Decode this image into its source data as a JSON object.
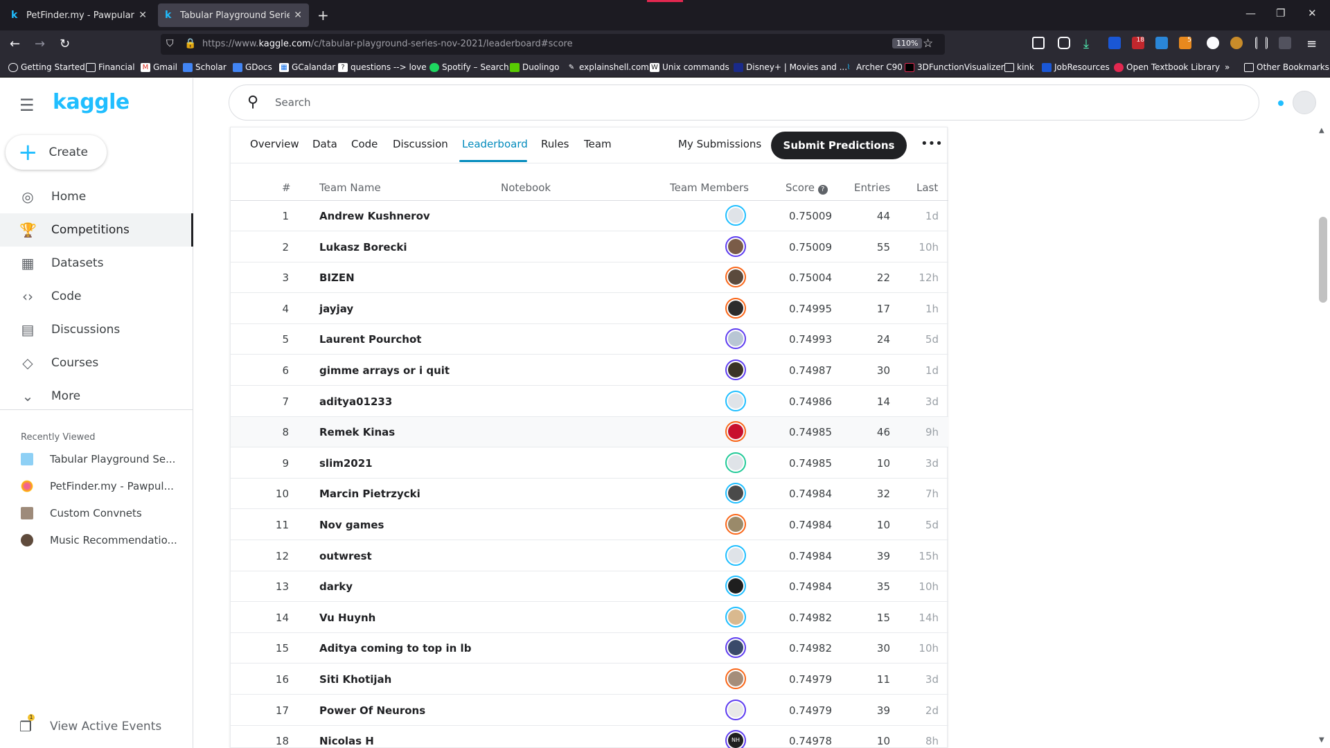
{
  "browser": {
    "tabs": [
      {
        "title": "PetFinder.my - Pawpularity Con",
        "active": false
      },
      {
        "title": "Tabular Playground Series - Nov",
        "active": true
      }
    ],
    "url_prefix": "https://www.",
    "url_domain": "kaggle.com",
    "url_path": "/c/tabular-playground-series-nov-2021/leaderboard#score",
    "zoom": "110%",
    "extension_badges": {
      "badge1": "18",
      "badge2": "5"
    },
    "bookmarks": [
      "Getting Started",
      "Financial",
      "Gmail",
      "Scholar",
      "GDocs",
      "GCalandar",
      "questions --> love",
      "Spotify – Search",
      "Duolingo",
      "explainshell.com",
      "Unix commands",
      "Disney+ | Movies and ...",
      "Archer C90",
      "3DFunctionVisualizer",
      "kink",
      "JobResources",
      "Open Textbook Library"
    ],
    "other_bookmarks": "Other Bookmarks"
  },
  "app": {
    "logo": "kaggle",
    "create_label": "Create",
    "nav": [
      {
        "label": "Home",
        "icon": "compass-icon"
      },
      {
        "label": "Competitions",
        "icon": "trophy-icon"
      },
      {
        "label": "Datasets",
        "icon": "table-icon"
      },
      {
        "label": "Code",
        "icon": "code-icon"
      },
      {
        "label": "Discussions",
        "icon": "comment-icon"
      },
      {
        "label": "Courses",
        "icon": "graduation-cap-icon"
      },
      {
        "label": "More",
        "icon": "chevron-down-icon"
      }
    ],
    "recently_viewed_title": "Recently Viewed",
    "recently_viewed": [
      {
        "label": "Tabular Playground Se..."
      },
      {
        "label": "PetFinder.my - Pawpul..."
      },
      {
        "label": "Custom Convnets"
      },
      {
        "label": "Music Recommendatio..."
      }
    ],
    "events_label": "View Active Events",
    "events_badge": "1",
    "search_placeholder": "Search"
  },
  "competition": {
    "tabs": [
      "Overview",
      "Data",
      "Code",
      "Discussion",
      "Leaderboard",
      "Rules",
      "Team"
    ],
    "active_tab": "Leaderboard",
    "my_submissions": "My Submissions",
    "submit_label": "Submit Predictions",
    "more_label": "•••"
  },
  "leaderboard": {
    "columns": {
      "rank": "#",
      "team": "Team Name",
      "notebook": "Notebook",
      "members": "Team Members",
      "score": "Score",
      "entries": "Entries",
      "last": "Last"
    },
    "rows": [
      {
        "rank": "1",
        "team": "Andrew Kushnerov",
        "score": "0.75009",
        "entries": "44",
        "last": "1d"
      },
      {
        "rank": "2",
        "team": "Lukasz Borecki",
        "score": "0.75009",
        "entries": "55",
        "last": "10h"
      },
      {
        "rank": "3",
        "team": "BIZEN",
        "score": "0.75004",
        "entries": "22",
        "last": "12h"
      },
      {
        "rank": "4",
        "team": "jayjay",
        "score": "0.74995",
        "entries": "17",
        "last": "1h"
      },
      {
        "rank": "5",
        "team": "Laurent Pourchot",
        "score": "0.74993",
        "entries": "24",
        "last": "5d"
      },
      {
        "rank": "6",
        "team": "gimme arrays or i quit",
        "score": "0.74987",
        "entries": "30",
        "last": "1d"
      },
      {
        "rank": "7",
        "team": "aditya01233",
        "score": "0.74986",
        "entries": "14",
        "last": "3d"
      },
      {
        "rank": "8",
        "team": "Remek Kinas",
        "score": "0.74985",
        "entries": "46",
        "last": "9h"
      },
      {
        "rank": "9",
        "team": "slim2021",
        "score": "0.74985",
        "entries": "10",
        "last": "3d"
      },
      {
        "rank": "10",
        "team": "Marcin Pietrzycki",
        "score": "0.74984",
        "entries": "32",
        "last": "7h"
      },
      {
        "rank": "11",
        "team": "Nov games",
        "score": "0.74984",
        "entries": "10",
        "last": "5d"
      },
      {
        "rank": "12",
        "team": "outwrest",
        "score": "0.74984",
        "entries": "39",
        "last": "15h"
      },
      {
        "rank": "13",
        "team": "darky",
        "score": "0.74984",
        "entries": "35",
        "last": "10h"
      },
      {
        "rank": "14",
        "team": "Vu Huynh",
        "score": "0.74982",
        "entries": "15",
        "last": "14h"
      },
      {
        "rank": "15",
        "team": "Aditya coming to top in lb",
        "score": "0.74982",
        "entries": "30",
        "last": "10h"
      },
      {
        "rank": "16",
        "team": "Siti Khotijah",
        "score": "0.74979",
        "entries": "11",
        "last": "3d"
      },
      {
        "rank": "17",
        "team": "Power Of Neurons",
        "score": "0.74979",
        "entries": "39",
        "last": "2d"
      },
      {
        "rank": "18",
        "team": "Nicolas H",
        "score": "0.74978",
        "entries": "10",
        "last": "8h"
      }
    ],
    "avatar_initials_row18": "NH"
  },
  "colors": {
    "accent": "#20beff",
    "active_tab": "#008abc",
    "tier_purple": "#5d3cf0",
    "tier_orange": "#f96517",
    "tier_teal": "#1ebeff",
    "tier_green": "#20c997"
  }
}
